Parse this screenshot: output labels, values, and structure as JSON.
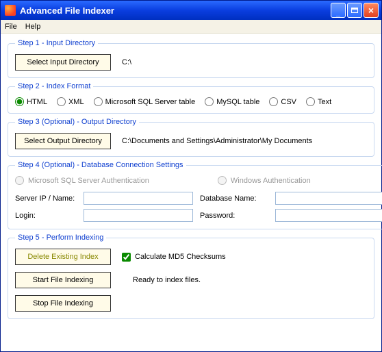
{
  "window": {
    "title": "Advanced File Indexer"
  },
  "menu": {
    "file": "File",
    "help": "Help"
  },
  "step1": {
    "legend": "Step 1 - Input Directory",
    "button": "Select Input Directory",
    "path": "C:\\"
  },
  "step2": {
    "legend": "Step 2 - Index Format",
    "options": {
      "html": "HTML",
      "xml": "XML",
      "mssql": "Microsoft SQL Server table",
      "mysql": "MySQL table",
      "csv": "CSV",
      "text": "Text"
    }
  },
  "step3": {
    "legend": "Step 3 (Optional) - Output Directory",
    "button": "Select Output Directory",
    "path": "C:\\Documents and Settings\\Administrator\\My Documents"
  },
  "step4": {
    "legend": "Step 4 (Optional) - Database Connection Settings",
    "auth_sql": "Microsoft SQL Server Authentication",
    "auth_win": "Windows Authentication",
    "server_label": "Server IP / Name:",
    "db_label": "Database Name:",
    "login_label": "Login:",
    "pass_label": "Password:",
    "server_val": "",
    "db_val": "",
    "login_val": "",
    "pass_val": ""
  },
  "step5": {
    "legend": "Step 5 - Perform Indexing",
    "delete_btn": "Delete Existing Index",
    "md5_label": "Calculate MD5 Checksums",
    "start_btn": "Start File Indexing",
    "stop_btn": "Stop File Indexing",
    "status": "Ready to index files."
  }
}
